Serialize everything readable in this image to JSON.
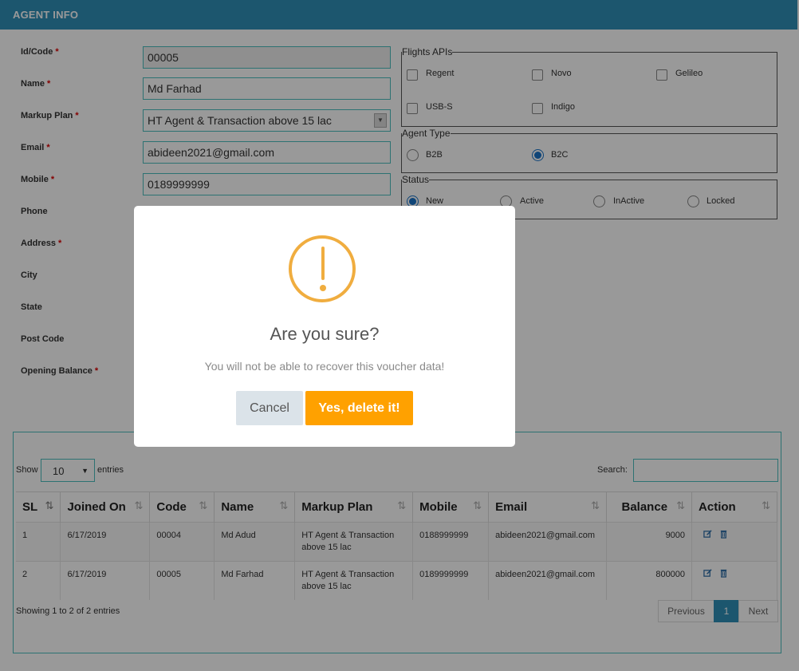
{
  "header": {
    "title": "AGENT INFO"
  },
  "form": {
    "fields": [
      {
        "label": "Id/Code",
        "required": "*",
        "value": "00005"
      },
      {
        "label": "Name",
        "required": "*",
        "value": "Md Farhad"
      },
      {
        "label": "Markup Plan",
        "required": "*",
        "value": "HT Agent & Transaction above 15 lac"
      },
      {
        "label": "Email",
        "required": "*",
        "value": "abideen2021@gmail.com"
      },
      {
        "label": "Mobile",
        "required": "*",
        "value": "0189999999"
      },
      {
        "label": "Phone",
        "required": ""
      },
      {
        "label": "Address",
        "required": "*"
      },
      {
        "label": "City",
        "required": ""
      },
      {
        "label": "State",
        "required": ""
      },
      {
        "label": "Post Code",
        "required": ""
      },
      {
        "label": "Opening Balance",
        "required": "*"
      }
    ]
  },
  "flights_apis": {
    "legend": "Flights APIs",
    "options": [
      "Regent",
      "Novo",
      "Gelileo",
      "USB-S",
      "Indigo"
    ]
  },
  "agent_type": {
    "legend": "Agent Type",
    "options": [
      "B2B",
      "B2C"
    ],
    "selected": "B2C"
  },
  "status": {
    "legend": "Status",
    "options": [
      "New",
      "Active",
      "InActive",
      "Locked"
    ],
    "selected": "New"
  },
  "table": {
    "show_label": "Show",
    "length_value": "10",
    "entries_label": "entries",
    "search_label": "Search:",
    "columns": [
      "SL",
      "Joined On",
      "Code",
      "Name",
      "Markup Plan",
      "Mobile",
      "Email",
      "Balance",
      "Action"
    ],
    "rows": [
      {
        "sl": "1",
        "joined": "6/17/2019",
        "code": "00004",
        "name": "Md Adud",
        "plan_l1": "HT Agent & Transaction",
        "plan_l2": "above 15 lac",
        "mobile": "0188999999",
        "email": "abideen2021@gmail.com",
        "balance": "9000"
      },
      {
        "sl": "2",
        "joined": "6/17/2019",
        "code": "00005",
        "name": "Md Farhad",
        "plan_l1": "HT Agent & Transaction",
        "plan_l2": "above 15 lac",
        "mobile": "0189999999",
        "email": "abideen2021@gmail.com",
        "balance": "800000"
      }
    ],
    "info": "Showing 1 to 2 of 2 entries",
    "pager": {
      "previous": "Previous",
      "current": "1",
      "next": "Next"
    }
  },
  "modal": {
    "icon": "warning-icon",
    "title": "Are you sure?",
    "text": "You will not be able to recover this voucher data!",
    "cancel_label": "Cancel",
    "confirm_label": "Yes, delete it!",
    "colors": {
      "warning": "#f0ad3f",
      "confirm": "#ffa100",
      "cancel": "#dbe3e9"
    }
  },
  "colors": {
    "header": "#2f8fb8",
    "input_border": "#4cbfbf"
  }
}
